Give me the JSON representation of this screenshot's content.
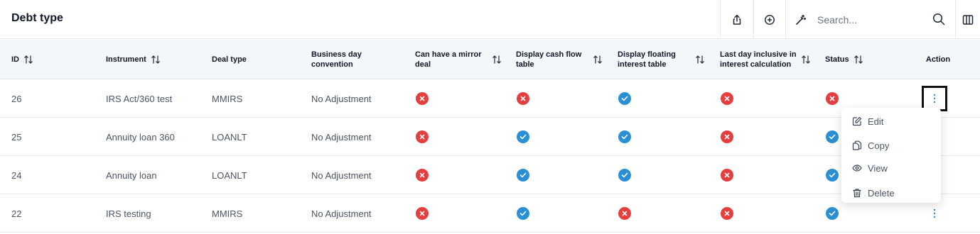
{
  "header": {
    "title": "Debt type"
  },
  "toolbar": {
    "export_icon": "share-icon",
    "add_icon": "plus-circle-icon",
    "magic_icon": "magic-wand-icon",
    "columns_icon": "columns-icon",
    "search_placeholder": "Search..."
  },
  "table": {
    "columns": [
      {
        "label": "ID",
        "sortable": true
      },
      {
        "label": "Instrument",
        "sortable": true
      },
      {
        "label": "Deal type",
        "sortable": false
      },
      {
        "label": "Business day convention",
        "sortable": false
      },
      {
        "label": "Can have a mirror deal",
        "sortable": true
      },
      {
        "label": "Display cash flow table",
        "sortable": true
      },
      {
        "label": "Display floating interest table",
        "sortable": true
      },
      {
        "label": "Last day inclusive in interest calculation",
        "sortable": true
      },
      {
        "label": "Status",
        "sortable": true
      },
      {
        "label": "Action",
        "sortable": false
      }
    ],
    "rows": [
      {
        "id": "26",
        "instrument": "IRS Act/360 test",
        "deal_type": "MMIRS",
        "convention": "No Adjustment",
        "mirror": false,
        "cash_flow": false,
        "floating": true,
        "last_day": false,
        "status": false
      },
      {
        "id": "25",
        "instrument": "Annuity loan 360",
        "deal_type": "LOANLT",
        "convention": "No Adjustment",
        "mirror": false,
        "cash_flow": true,
        "floating": true,
        "last_day": false,
        "status": true
      },
      {
        "id": "24",
        "instrument": "Annuity loan",
        "deal_type": "LOANLT",
        "convention": "No Adjustment",
        "mirror": false,
        "cash_flow": true,
        "floating": true,
        "last_day": false,
        "status": true
      },
      {
        "id": "22",
        "instrument": "IRS testing",
        "deal_type": "MMIRS",
        "convention": "No Adjustment",
        "mirror": false,
        "cash_flow": true,
        "floating": false,
        "last_day": false,
        "status": true
      }
    ]
  },
  "action_menu": {
    "items": [
      {
        "label": "Edit",
        "icon": "edit-icon"
      },
      {
        "label": "Copy",
        "icon": "copy-icon"
      },
      {
        "label": "View",
        "icon": "eye-icon"
      },
      {
        "label": "Delete",
        "icon": "trash-icon"
      }
    ]
  },
  "colors": {
    "no": "#e53e3e",
    "yes": "#2b8fd6",
    "header_bg": "#f3f7fa",
    "kebab": "#2b8fd6"
  }
}
